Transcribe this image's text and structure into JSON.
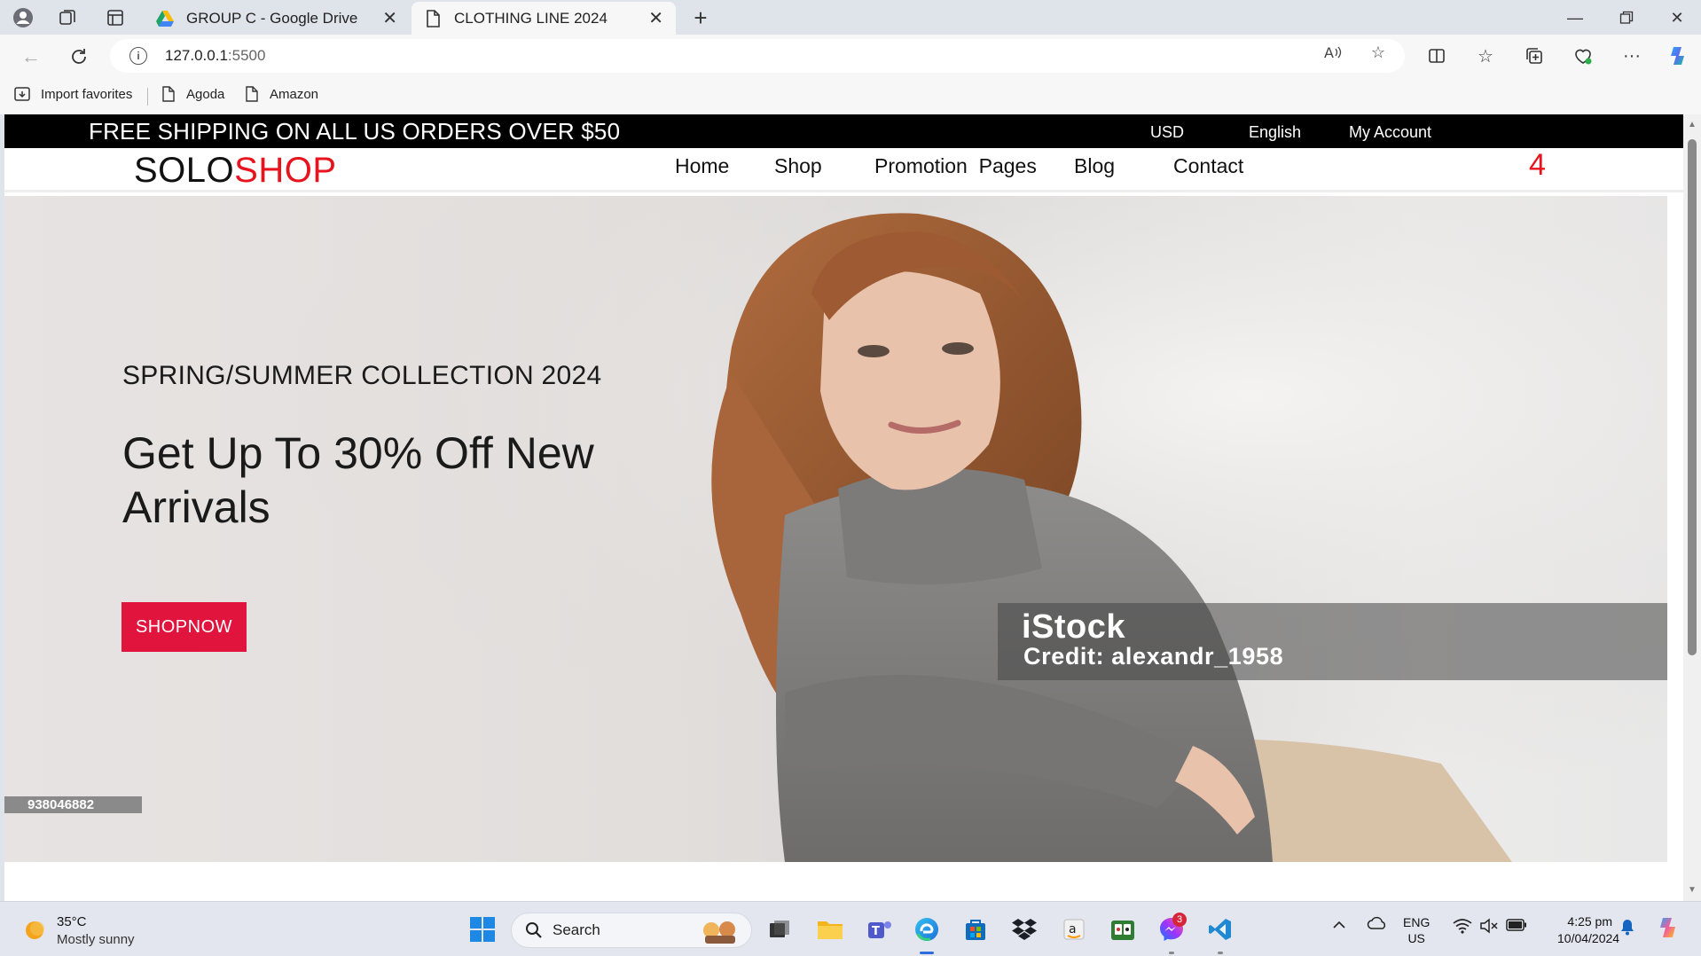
{
  "browser": {
    "tabs": [
      {
        "title": "GROUP C - Google Drive",
        "active": false
      },
      {
        "title": "CLOTHING LINE 2024",
        "active": true
      }
    ],
    "new_tab_icon": "plus-icon",
    "address": {
      "host": "127.0.0.1",
      "port": ":5500"
    },
    "favorites": [
      {
        "label": "Import favorites",
        "icon": "import-icon"
      },
      {
        "label": "Agoda",
        "icon": "page-icon"
      },
      {
        "label": "Amazon",
        "icon": "page-icon"
      }
    ]
  },
  "site": {
    "promo": "FREE SHIPPING ON ALL US ORDERS OVER $50",
    "currency": "USD",
    "language": "English",
    "account": "My Account",
    "logo": {
      "part1": "SOLO",
      "part2": "SHOP"
    },
    "menu": [
      "Home",
      "Shop",
      "Promotion  Pages",
      "Blog",
      "Contact"
    ],
    "cart_count": "4",
    "hero": {
      "subtitle": "SPRING/SUMMER COLLECTION 2024",
      "title": "Get Up To 30% Off New Arrivals",
      "cta": "SHOPNOW",
      "watermark_brand": "iStock",
      "watermark_credit": "Credit: alexandr_1958",
      "image_id": "938046882"
    }
  },
  "taskbar": {
    "weather": {
      "temp": "35°C",
      "desc": "Mostly sunny"
    },
    "search": "Search",
    "messenger_badge": "3",
    "lang": {
      "line1": "ENG",
      "line2": "US"
    },
    "time": "4:25 pm",
    "date": "10/04/2024"
  },
  "colors": {
    "accent_red": "#e8141d",
    "cta_red": "#e0143c",
    "edge_blue": "#2d6cdf"
  }
}
